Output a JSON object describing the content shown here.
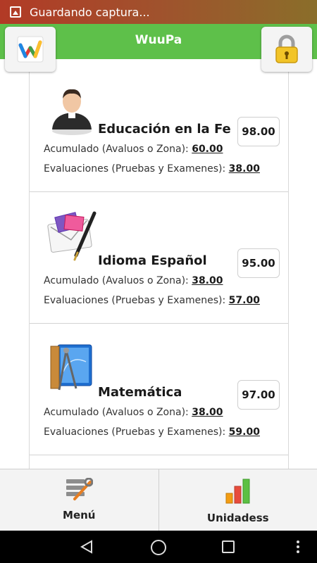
{
  "status_bar": {
    "notification": "Guardando captura..."
  },
  "header": {
    "title": "WuuPa"
  },
  "subjects": [
    {
      "name": "Educación en la Fe",
      "grade": "98.00",
      "acumulado_label": "Acumulado (Avaluos o Zona): ",
      "acumulado_value": "60.00",
      "evaluaciones_label": "Evaluaciones (Pruebas y Examenes): ",
      "evaluaciones_value": "38.00",
      "icon": "priest-icon"
    },
    {
      "name": "Idioma Español",
      "grade": "95.00",
      "acumulado_label": "Acumulado (Avaluos o Zona): ",
      "acumulado_value": "38.00",
      "evaluaciones_label": "Evaluaciones (Pruebas y Examenes): ",
      "evaluaciones_value": "57.00",
      "icon": "letter-pen-icon"
    },
    {
      "name": "Matemática",
      "grade": "97.00",
      "acumulado_label": "Acumulado (Avaluos o Zona): ",
      "acumulado_value": "38.00",
      "evaluaciones_label": "Evaluaciones (Pruebas y Examenes): ",
      "evaluaciones_value": "59.00",
      "icon": "compass-book-icon"
    }
  ],
  "tabs": {
    "menu_label": "Menú",
    "unidades_label": "Unidadess"
  },
  "colors": {
    "header_green": "#5ec04a",
    "status_bar": "#a0522d"
  }
}
